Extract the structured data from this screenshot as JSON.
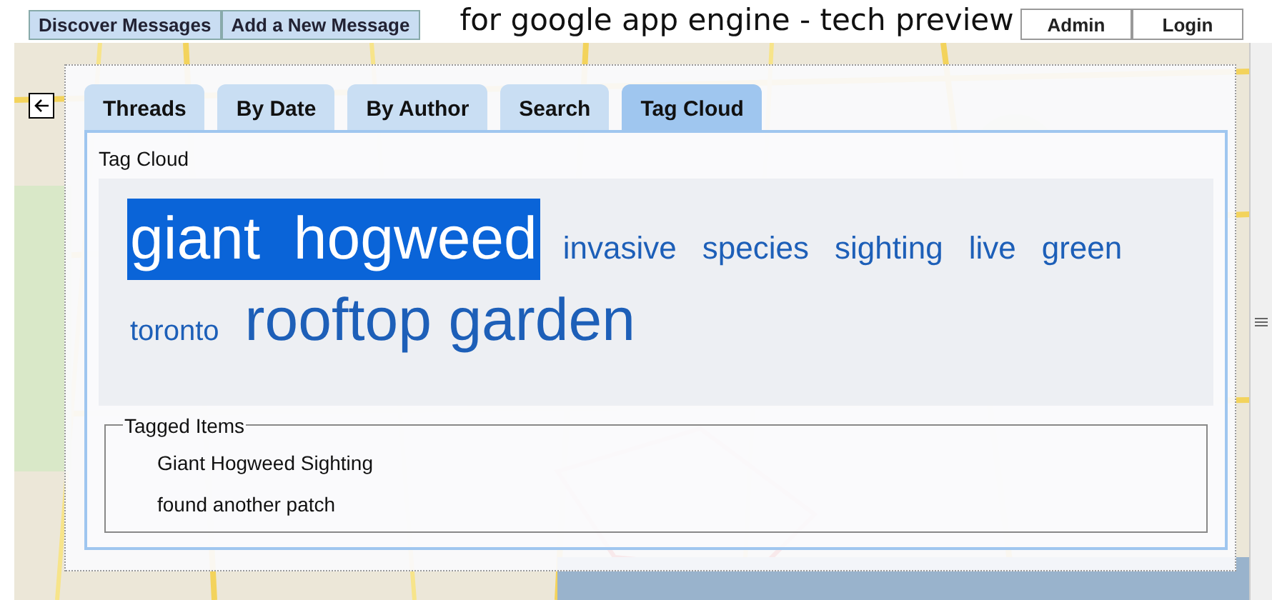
{
  "header": {
    "nav_buttons": [
      "Discover Messages",
      "Add a New Message"
    ],
    "title": "for google app engine - tech preview",
    "account_buttons": [
      "Admin",
      "Login"
    ]
  },
  "tabs": [
    {
      "label": "Threads",
      "selected": false
    },
    {
      "label": "By Date",
      "selected": false
    },
    {
      "label": "By Author",
      "selected": false
    },
    {
      "label": "Search",
      "selected": false
    },
    {
      "label": "Tag Cloud",
      "selected": true
    }
  ],
  "panel_title": "Tag Cloud",
  "tags": [
    {
      "text": "giant  hogweed",
      "kind": "top",
      "selected": true
    },
    {
      "text": "invasive",
      "kind": "light",
      "selected": false
    },
    {
      "text": "species",
      "kind": "light",
      "selected": false
    },
    {
      "text": "sighting",
      "kind": "light",
      "selected": false
    },
    {
      "text": "live",
      "kind": "light",
      "selected": false
    },
    {
      "text": "green",
      "kind": "light",
      "selected": false
    },
    {
      "text": "toronto",
      "kind": "lightest",
      "selected": false
    },
    {
      "text": "rooftop garden",
      "kind": "heavy",
      "selected": false
    }
  ],
  "tagged_items": {
    "legend": "Tagged Items",
    "items": [
      "Giant Hogweed Sighting",
      "found another patch"
    ]
  }
}
